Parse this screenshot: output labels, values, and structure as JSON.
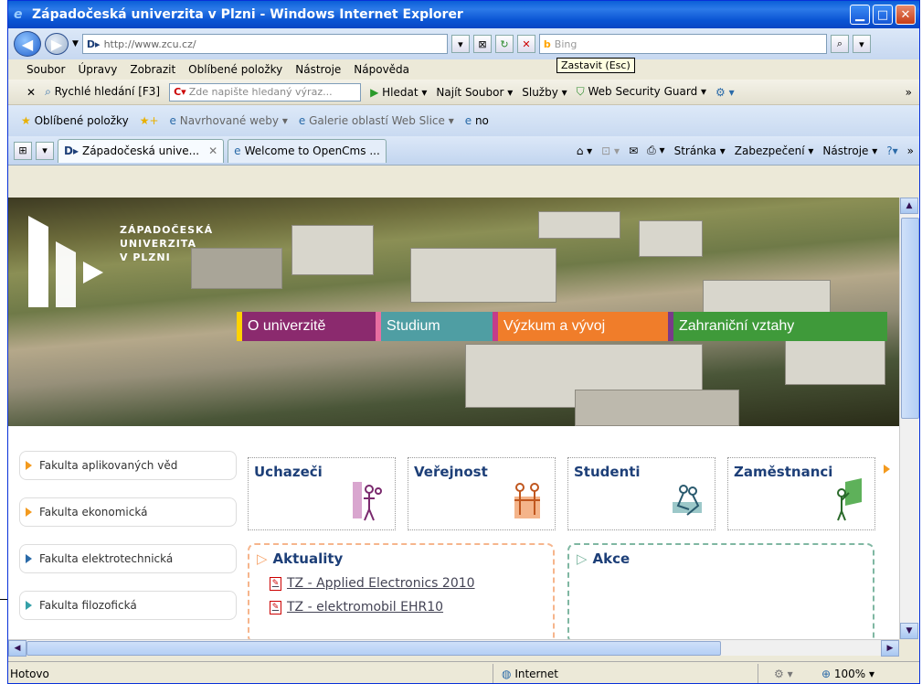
{
  "window": {
    "title": "Západočeská univerzita v Plzni - Windows Internet Explorer"
  },
  "address": {
    "url": "http://www.zcu.cz/",
    "search_placeholder": "Bing"
  },
  "menubar": {
    "items": [
      "Soubor",
      "Úpravy",
      "Zobrazit",
      "Oblíbené položky",
      "Nástroje",
      "Nápověda"
    ],
    "tooltip": "Zastavit (Esc)"
  },
  "toolbar": {
    "quick_search": "Rychlé hledání [F3]",
    "search_placeholder": "Zde napište hledaný výraz...",
    "search_btn": "Hledat",
    "find_file": "Najít Soubor",
    "services": "Služby",
    "guard": "Web Security Guard"
  },
  "favbar": {
    "favorites": "Oblíbené položky",
    "suggested": "Navrhované weby",
    "gallery": "Galerie oblastí Web Slice",
    "no": "no"
  },
  "tabs": [
    {
      "label": "Západočeská unive..."
    },
    {
      "label": "Welcome to OpenCms ..."
    }
  ],
  "cmdbar": {
    "page": "Stránka",
    "security": "Zabezpečení",
    "tools": "Nástroje"
  },
  "hero": {
    "logo_lines": [
      "ZÁPADOČESKÁ",
      "UNIVERZITA",
      "V PLZNI"
    ]
  },
  "topmenu": [
    {
      "label": "O univerzitě",
      "color": "#8b2a6e"
    },
    {
      "label": "Studium",
      "color": "#4f9ea3"
    },
    {
      "label": "Výzkum a vývoj",
      "color": "#f07d2a"
    },
    {
      "label": "Zahraniční vztahy",
      "color": "#3f9a3a"
    }
  ],
  "sidebar": {
    "items": [
      "Fakulta aplikovaných věd",
      "Fakulta ekonomická",
      "Fakulta elektrotechnická",
      "Fakulta filozofická"
    ]
  },
  "cards": [
    "Uchazeči",
    "Veřejnost",
    "Studenti",
    "Zaměstnanci"
  ],
  "news": {
    "title": "Aktuality",
    "items": [
      "TZ - Applied Electronics 2010",
      "TZ - elektromobil EHR10"
    ]
  },
  "events": {
    "title": "Akce"
  },
  "status": {
    "left": "Hotovo",
    "zone": "Internet",
    "zoom": "100%"
  }
}
